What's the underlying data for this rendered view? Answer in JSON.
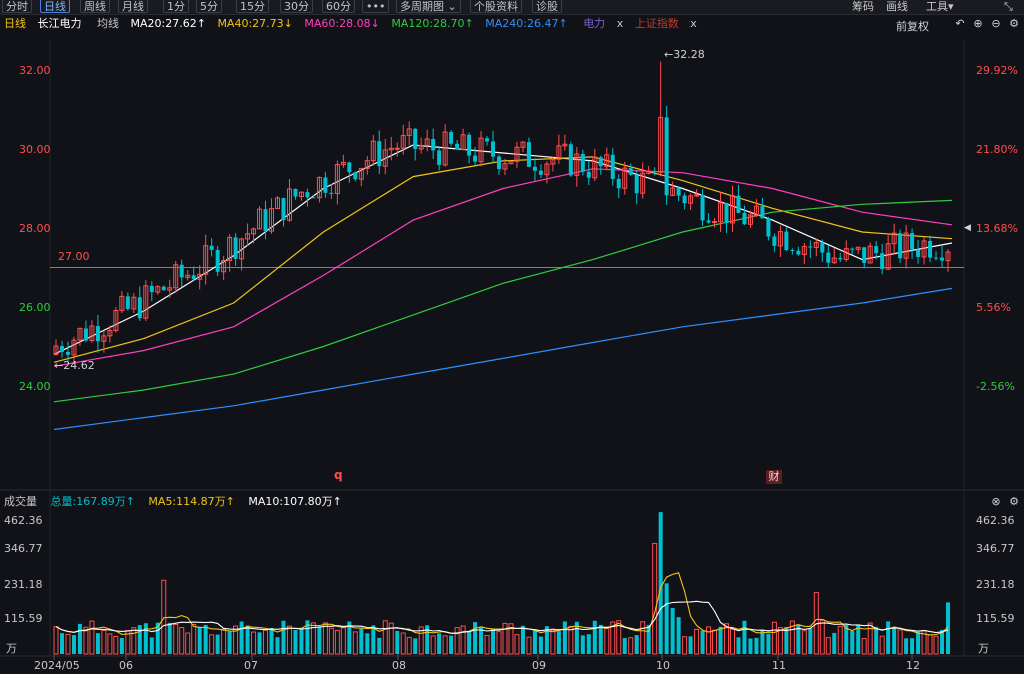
{
  "toolbar": {
    "tabs": [
      "分时",
      "日线",
      "周线",
      "月线",
      "1分",
      "5分",
      "15分",
      "30分",
      "60分",
      "•••",
      "多周期图 ⌄",
      "个股资料",
      "诊股"
    ],
    "active_tab": "日线",
    "right": [
      "筹码",
      "画线",
      "工具▾"
    ]
  },
  "price_legend": {
    "period": "日线",
    "stock": "长江电力",
    "avg_label": "均线",
    "ma20": "MA20:27.62↑",
    "ma40": "MA40:27.73↓",
    "ma60": "MA60:28.08↓",
    "ma120": "MA120:28.70↑",
    "ma240": "MA240:26.47↑",
    "tag1": "电力",
    "tag2": "上证指数",
    "close_x": "x",
    "adjust": "前复权"
  },
  "volume_legend": {
    "label": "成交量",
    "total": "总量:167.89万↑",
    "ma5": "MA5:114.87万↑",
    "ma10": "MA10:107.80万↑"
  },
  "colors": {
    "up": "#ff4d4f",
    "down": "#00c0d0",
    "ma20": "#ffffff",
    "ma40": "#f0c419",
    "ma60": "#ff3fbf",
    "ma120": "#2ecc40",
    "ma240": "#2d8fff",
    "hline": "#ff4d4f"
  },
  "chart_data": [
    {
      "type": "candlestick",
      "title": "长江电力 日线",
      "x_ticks": [
        "2024/05",
        "06",
        "07",
        "08",
        "09",
        "10",
        "11",
        "12"
      ],
      "y_ticks": [
        "32.00",
        "30.00",
        "28.00",
        "26.00",
        "24.00"
      ],
      "y_ticks_right": [
        "29.92%",
        "21.80%",
        "13.68%",
        "5.56%",
        "-2.56%"
      ],
      "ylim": [
        22.0,
        32.6
      ],
      "annotations": {
        "high": "←32.28",
        "low": "←24.62",
        "hline": "27.00",
        "marker_q": "q",
        "marker_cai": "财"
      },
      "series": [
        {
          "name": "MA20",
          "x": [
            0,
            0.1,
            0.2,
            0.3,
            0.4,
            0.5,
            0.6,
            0.7,
            0.8,
            0.9,
            1
          ],
          "values": [
            24.8,
            25.9,
            27.3,
            29.0,
            30.1,
            29.9,
            29.7,
            29.0,
            28.2,
            27.2,
            27.62
          ]
        },
        {
          "name": "MA40",
          "x": [
            0,
            0.1,
            0.2,
            0.3,
            0.4,
            0.5,
            0.6,
            0.7,
            0.8,
            0.9,
            1
          ],
          "values": [
            24.6,
            25.2,
            26.1,
            27.9,
            29.3,
            29.7,
            29.8,
            29.2,
            28.5,
            27.9,
            27.73
          ]
        },
        {
          "name": "MA60",
          "x": [
            0,
            0.1,
            0.2,
            0.3,
            0.4,
            0.5,
            0.6,
            0.7,
            0.8,
            0.9,
            1
          ],
          "values": [
            24.5,
            24.9,
            25.5,
            26.8,
            28.2,
            29.0,
            29.5,
            29.4,
            29.0,
            28.4,
            28.08
          ]
        },
        {
          "name": "MA120",
          "x": [
            0,
            0.1,
            0.2,
            0.3,
            0.4,
            0.5,
            0.6,
            0.7,
            0.8,
            0.9,
            1
          ],
          "values": [
            23.6,
            23.9,
            24.3,
            25.0,
            25.8,
            26.6,
            27.2,
            27.9,
            28.4,
            28.6,
            28.7
          ]
        },
        {
          "name": "MA240",
          "x": [
            0,
            0.1,
            0.2,
            0.3,
            0.4,
            0.5,
            0.6,
            0.7,
            0.8,
            0.9,
            1
          ],
          "values": [
            22.9,
            23.2,
            23.5,
            23.9,
            24.3,
            24.7,
            25.1,
            25.5,
            25.8,
            26.1,
            26.47
          ]
        }
      ]
    },
    {
      "type": "bar",
      "title": "成交量",
      "y_ticks": [
        "462.36",
        "346.77",
        "231.18",
        "115.59",
        "万"
      ],
      "ylim": [
        0,
        462.36
      ],
      "unit": "万"
    }
  ]
}
